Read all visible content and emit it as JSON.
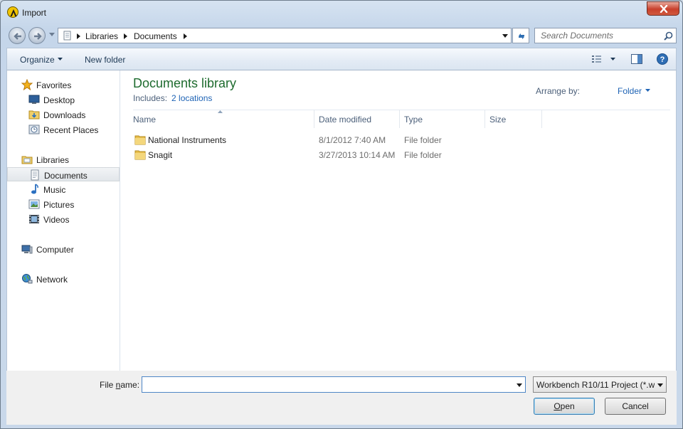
{
  "window": {
    "title": "Import",
    "close_label": ""
  },
  "nav": {
    "breadcrumbs": [
      "Libraries",
      "Documents"
    ],
    "search_placeholder": "Search Documents"
  },
  "toolbar": {
    "organize": "Organize",
    "new_folder": "New folder"
  },
  "sidebar": {
    "favorites": "Favorites",
    "favorites_items": [
      "Desktop",
      "Downloads",
      "Recent Places"
    ],
    "libraries": "Libraries",
    "libraries_items": [
      "Documents",
      "Music",
      "Pictures",
      "Videos"
    ],
    "computer": "Computer",
    "network": "Network",
    "selected": "Documents"
  },
  "library": {
    "title": "Documents library",
    "includes_label": "Includes:",
    "includes_link": "2 locations",
    "arrange_by_label": "Arrange by:",
    "arrange_by_value": "Folder"
  },
  "columns": {
    "name": "Name",
    "date": "Date modified",
    "type": "Type",
    "size": "Size"
  },
  "files": [
    {
      "name": "National Instruments",
      "date": "8/1/2012 7:40 AM",
      "type": "File folder"
    },
    {
      "name": "Snagit",
      "date": "3/27/2013 10:14 AM",
      "type": "File folder"
    }
  ],
  "footer": {
    "filename_label_pre": "File ",
    "filename_label_mn": "n",
    "filename_label_post": "ame:",
    "filename_value": "",
    "filetype": "Workbench R10/11 Project (*.w",
    "open_mn": "O",
    "open_rest": "pen",
    "cancel": "Cancel"
  },
  "colors": {
    "accent": "#1e63b5",
    "library_title": "#1e6b2e",
    "close": "#c8402c"
  }
}
